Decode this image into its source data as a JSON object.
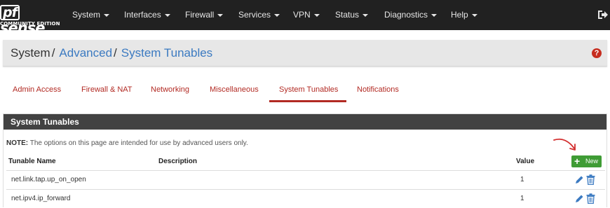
{
  "navbar": {
    "logo_mark": "sense",
    "logo_pf": "pf",
    "logo_edition": "COMMUNITY EDITION",
    "items": [
      {
        "label": "System"
      },
      {
        "label": "Interfaces"
      },
      {
        "label": "Firewall"
      },
      {
        "label": "Services"
      },
      {
        "label": "VPN"
      },
      {
        "label": "Status"
      },
      {
        "label": "Diagnostics"
      },
      {
        "label": "Help"
      }
    ],
    "logout_icon": "sign-out-icon"
  },
  "breadcrumb": {
    "root": "System",
    "parent": "Advanced",
    "current": "System Tunables",
    "separator": "/",
    "help_icon": "question-circle-icon",
    "help_glyph": "?"
  },
  "tabs": [
    {
      "label": "Admin Access",
      "active": false
    },
    {
      "label": "Firewall & NAT",
      "active": false
    },
    {
      "label": "Networking",
      "active": false
    },
    {
      "label": "Miscellaneous",
      "active": false
    },
    {
      "label": "System Tunables",
      "active": true
    },
    {
      "label": "Notifications",
      "active": false
    }
  ],
  "panel": {
    "title": "System Tunables",
    "note_label": "NOTE:",
    "note_text": " The options on this page are intended for use by advanced users only.",
    "columns": [
      "Tunable Name",
      "Description",
      "Value"
    ],
    "new_button": {
      "plus": "+",
      "label": "New"
    },
    "rows": [
      {
        "name": "net.link.tap.up_on_open",
        "description": "",
        "value": "1"
      },
      {
        "name": "net.ipv4.ip_forward",
        "description": "",
        "value": "1"
      }
    ]
  },
  "colors": {
    "navbar_bg": "#212121",
    "accent_red": "#b22a23",
    "link_blue": "#3b7ac1",
    "panel_header": "#424242",
    "new_button_green": "#3f9c35",
    "action_blue": "#3b7ac1",
    "annotation_arrow": "#d32f2f"
  }
}
